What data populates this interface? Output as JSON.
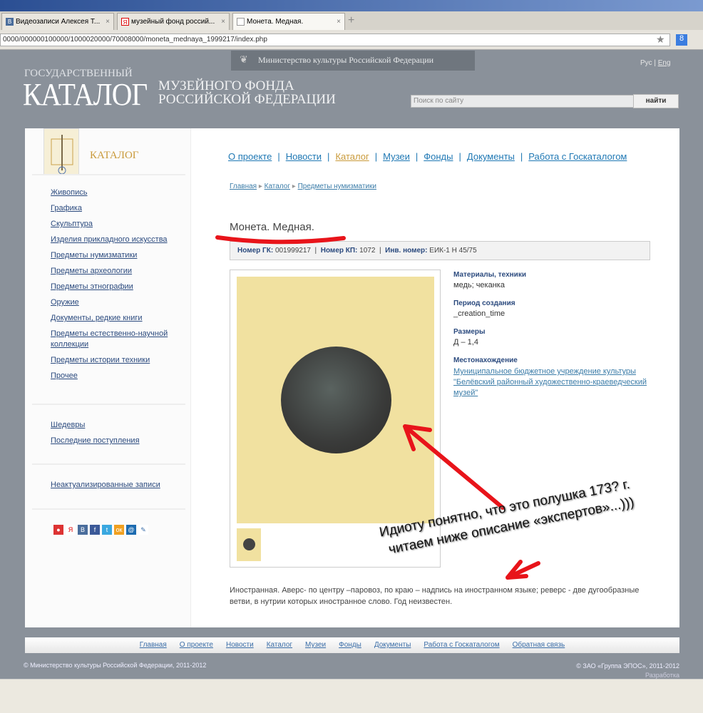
{
  "browser": {
    "tabs": [
      {
        "label": "Видеозаписи Алексея Т...",
        "icon": "В"
      },
      {
        "label": "музейный фонд россий...",
        "icon": "Я"
      },
      {
        "label": "Монета. Медная.",
        "icon": ""
      }
    ],
    "new_tab": "+",
    "close": "×",
    "url": "0000/000000100000/1000020000/70008000/moneta_mednaya_1999217/index.php",
    "search_engine": "8"
  },
  "header": {
    "ministry": "Министерство культуры Российской Федерации",
    "lang_ru": "Рус",
    "lang_sep": "|",
    "lang_en": "Eng",
    "logo_top": "ГОСУДАРСТВЕННЫЙ",
    "logo_main": "КАТАЛОГ",
    "logo_line1": "МУЗЕЙНОГО ФОНДА",
    "logo_line2": "РОССИЙСКОЙ ФЕДЕРАЦИИ",
    "search_placeholder": "Поиск по сайту",
    "search_button": "найти"
  },
  "sidebar": {
    "title": "КАТАЛОГ",
    "items": [
      "Живопись",
      "Графика",
      "Скульптура",
      "Изделия прикладного искусства",
      "Предметы нумизматики",
      "Предметы археологии",
      "Предметы этнографии",
      "Оружие",
      "Документы, редкие книги",
      "Предметы естественно-научной коллекции",
      "Предметы истории техники",
      "Прочее"
    ],
    "extra": [
      "Шедевры",
      "Последние поступления"
    ],
    "outdated": "Неактуализированные записи",
    "social": [
      "В",
      "f",
      "t",
      "ок",
      "@",
      "✎"
    ]
  },
  "nav": [
    "О проекте",
    "Новости",
    "Каталог",
    "Музеи",
    "Фонды",
    "Документы",
    "Работа с Госкаталогом"
  ],
  "breadcrumbs": [
    "Главная",
    "Каталог",
    "Предметы нумизматики"
  ],
  "item": {
    "title": "Монета. Медная.",
    "gk_label": "Номер ГК:",
    "gk": "001999217",
    "kp_label": "Номер КП:",
    "kp": "1072",
    "inv_label": "Инв. номер:",
    "inv": "ЕИК-1 Н 45/75",
    "props": [
      {
        "label": "Материалы, техники",
        "value": "медь; чеканка"
      },
      {
        "label": "Период создания",
        "value": "_creation_time"
      },
      {
        "label": "Размеры",
        "value": "Д – 1,4"
      },
      {
        "label": "Местонахождение",
        "value": "Муниципальное бюджетное учреждение культуры \"Белёвский районный художественно-краеведческий музей\""
      }
    ],
    "description": "Иностранная. Аверс- по центру –паровоз, по краю – надпись на иностранном языке; реверс - две дугообразные ветви, в нутрии которых иностранное слово. Год неизвестен."
  },
  "annotation": {
    "line1": "Идиоту понятно, что это полушка 173? г.",
    "line2": "читаем ниже описание «экспертов»...)))",
    "color": "#e8141a"
  },
  "footer": {
    "links": [
      "Главная",
      "О проекте",
      "Новости",
      "Каталог",
      "Музеи",
      "Фонды",
      "Документы",
      "Работа с Госкаталогом",
      "Обратная связь"
    ],
    "copyright_left": "© Министерство культуры Российской Федерации, 2011-2012",
    "copyright_right": "© ЗАО «Группа ЭПОС», 2011-2012",
    "dev": "Разработка"
  }
}
